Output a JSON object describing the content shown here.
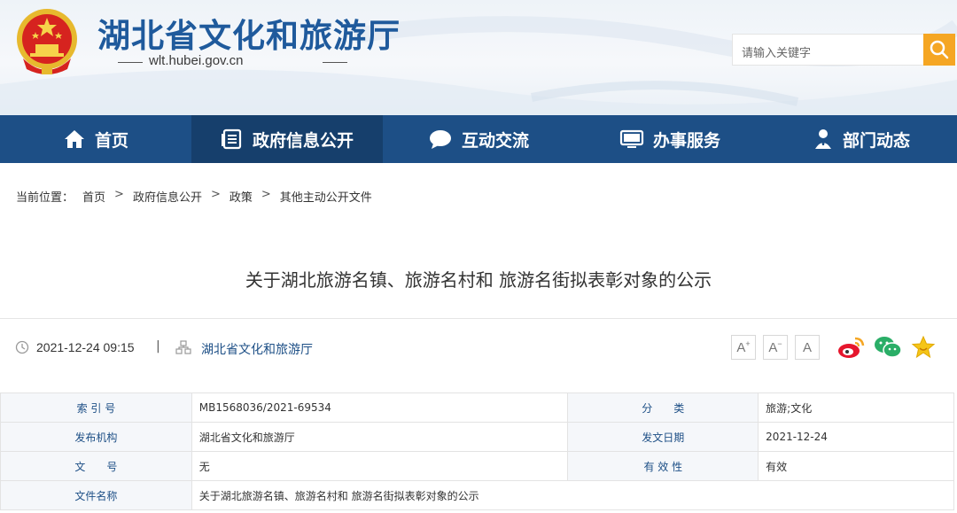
{
  "header": {
    "site_title": "湖北省文化和旅游厅",
    "domain": "wlt.hubei.gov.cn",
    "search_placeholder": "请输入关键字",
    "colors": {
      "title": "#1f5a9c",
      "nav": "#1d4f86",
      "nav_active": "#163f6c",
      "search_button": "#f5a623"
    }
  },
  "nav": {
    "items": [
      {
        "label": "首页",
        "icon": "home-icon"
      },
      {
        "label": "政府信息公开",
        "icon": "document-list-icon",
        "active": true
      },
      {
        "label": "互动交流",
        "icon": "chat-bubble-icon"
      },
      {
        "label": "办事服务",
        "icon": "monitor-icon"
      },
      {
        "label": "部门动态",
        "icon": "person-badge-icon"
      }
    ]
  },
  "breadcrumb": {
    "prefix": "当前位置：",
    "items": [
      "首页",
      "政府信息公开",
      "政策",
      "其他主动公开文件"
    ],
    "separator": ">"
  },
  "article": {
    "title": "关于湖北旅游名镇、旅游名村和 旅游名街拟表彰对象的公示",
    "datetime": "2021-12-24 09:15",
    "meta_separator": "|",
    "source": "湖北省文化和旅游厅",
    "font_buttons": [
      "A",
      "A",
      "A"
    ]
  },
  "info_table": {
    "index_label": "索 引 号",
    "index_value": "MB1568036/2021-69534",
    "category_label": "分　　类",
    "category_value": "旅游;文化",
    "issuer_label": "发布机构",
    "issuer_value": "湖北省文化和旅游厅",
    "date_label": "发文日期",
    "date_value": "2021-12-24",
    "docno_label": "文　　号",
    "docno_value": "无",
    "validity_label": "有 效 性",
    "validity_value": "有效",
    "docname_label": "文件名称",
    "docname_value": "关于湖北旅游名镇、旅游名村和 旅游名街拟表彰对象的公示"
  }
}
